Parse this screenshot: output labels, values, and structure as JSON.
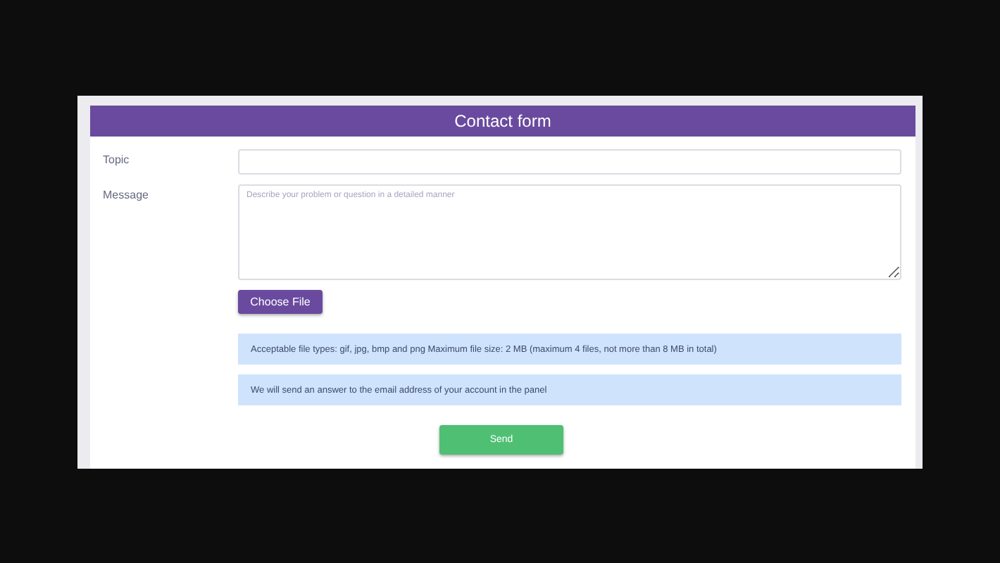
{
  "form": {
    "title": "Contact form",
    "fields": [
      {
        "kind": "input",
        "label": "Topic"
      },
      {
        "kind": "textarea",
        "label": "Message",
        "placeholder": "Describe your problem or question in a detailed manner"
      }
    ],
    "file_button": "Choose File",
    "notices": [
      "Acceptable file types: gif, jpg, bmp and png Maximum file size: 2 MB (maximum 4 files, not more than 8 MB in total)",
      "We will send an answer to the email address of your account in the panel"
    ],
    "submit": "Send"
  }
}
